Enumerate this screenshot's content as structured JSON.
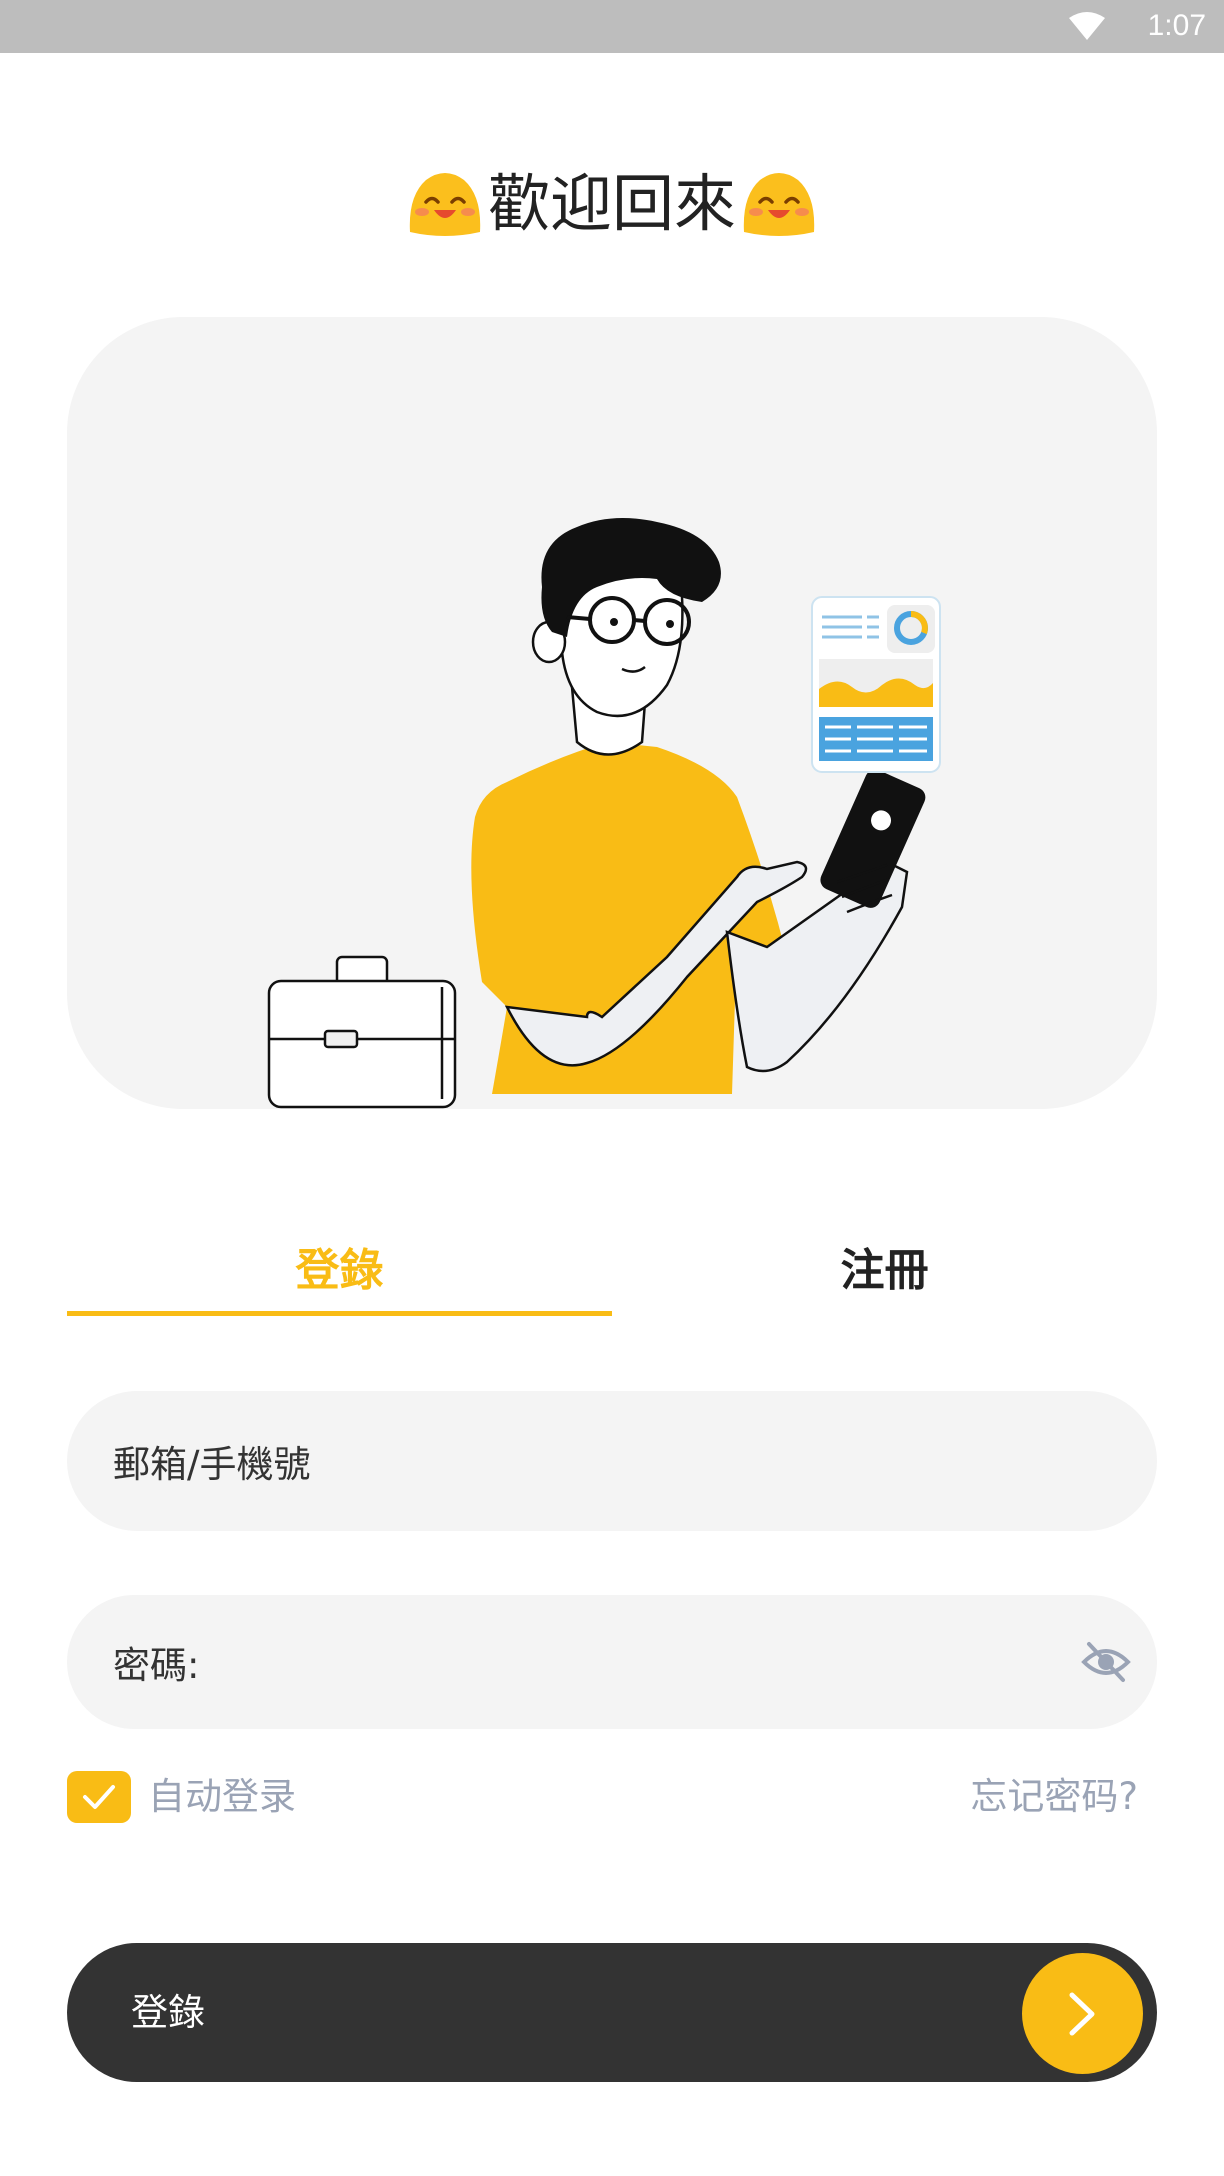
{
  "status_bar": {
    "time": "1:07",
    "wifi_icon": "wifi-icon"
  },
  "header": {
    "welcome_text": "歡迎回來",
    "emoji_icon": "smiling-face-icon"
  },
  "tabs": [
    {
      "label": "登錄",
      "active": true
    },
    {
      "label": "注冊",
      "active": false
    }
  ],
  "form": {
    "email_placeholder": "郵箱/手機號",
    "password_label": "密碼:",
    "password_toggle_icon": "eye-off-icon",
    "auto_login_label": "自动登录",
    "auto_login_checked": true,
    "forgot_password": "忘记密码?"
  },
  "submit": {
    "label": "登錄",
    "arrow_icon": "chevron-right-icon"
  },
  "colors": {
    "accent": "#f9bc15",
    "dark": "#333333",
    "muted": "#9aa3b5",
    "field_bg": "#f4f4f4"
  }
}
